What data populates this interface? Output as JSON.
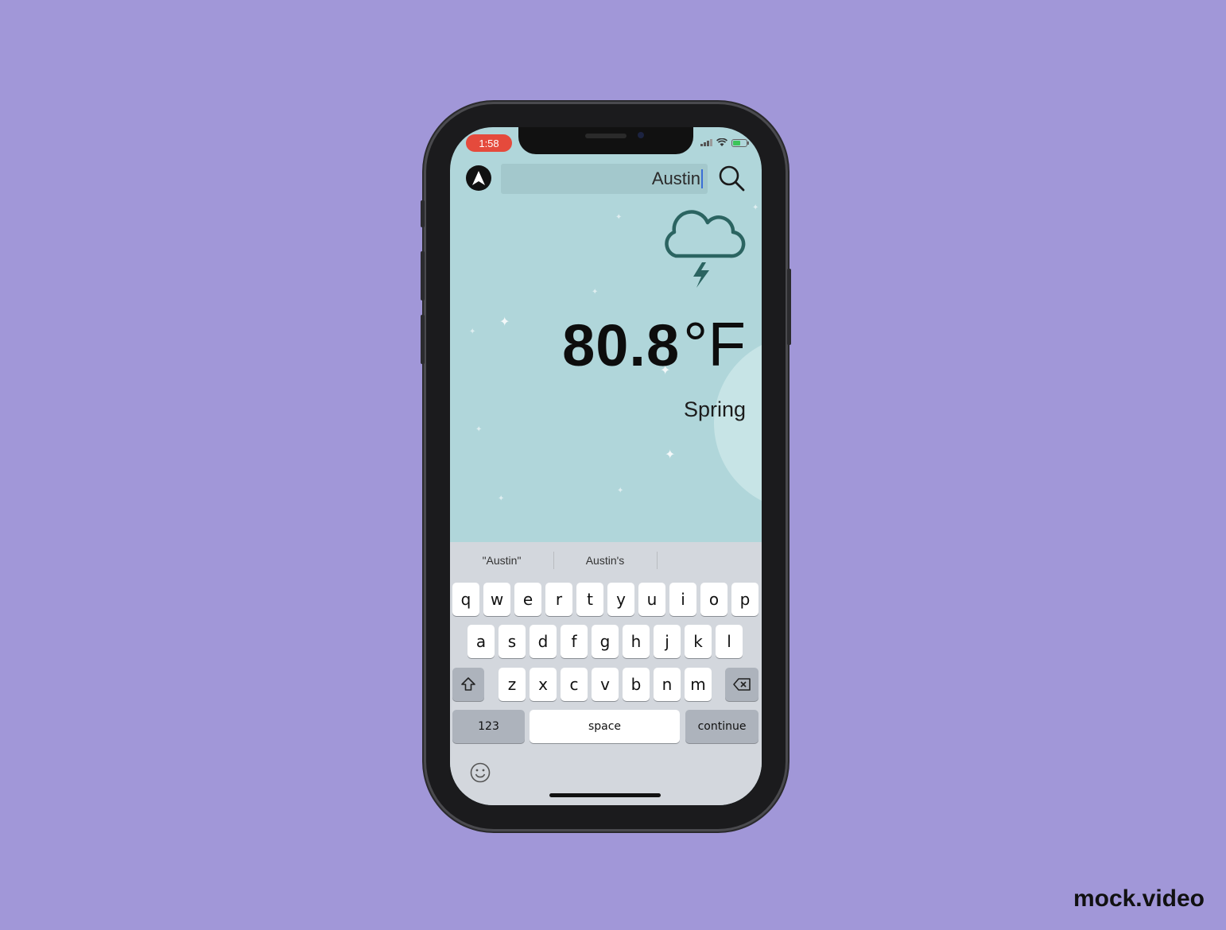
{
  "status_bar": {
    "time": "1:58"
  },
  "search": {
    "query": "Austin"
  },
  "weather": {
    "temperature": "80.8",
    "unit": "°F",
    "season": "Spring",
    "icon": "cloud-lightning-icon"
  },
  "keyboard": {
    "suggestions": [
      "\"Austin\"",
      "Austin's",
      ""
    ],
    "row1": [
      "q",
      "w",
      "e",
      "r",
      "t",
      "y",
      "u",
      "i",
      "o",
      "p"
    ],
    "row2": [
      "a",
      "s",
      "d",
      "f",
      "g",
      "h",
      "j",
      "k",
      "l"
    ],
    "row3": [
      "z",
      "x",
      "c",
      "v",
      "b",
      "n",
      "m"
    ],
    "numbers_label": "123",
    "space_label": "space",
    "return_label": "continue"
  },
  "watermark": "mock.video",
  "colors": {
    "background": "#a197d8",
    "screen": "#b0d6da",
    "accent_icon": "#2b6461",
    "time_pill": "#e54a3c"
  }
}
